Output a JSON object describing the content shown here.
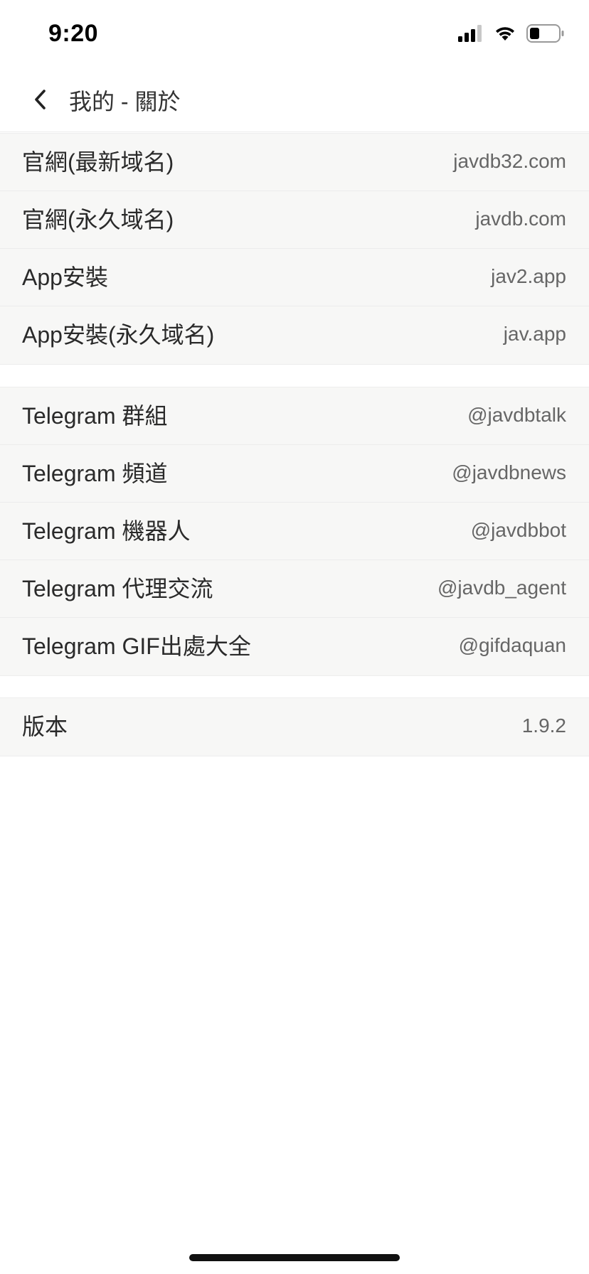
{
  "status_bar": {
    "time": "9:20",
    "icons": [
      "signal-icon",
      "wifi-icon",
      "battery-icon"
    ]
  },
  "nav": {
    "back_icon": "chevron-left-icon",
    "title": "我的 - 關於"
  },
  "groups": [
    {
      "rows": [
        {
          "label": "官網(最新域名)",
          "value": "javdb32.com"
        },
        {
          "label": "官網(永久域名)",
          "value": "javdb.com"
        },
        {
          "label": "App安裝",
          "value": "jav2.app"
        },
        {
          "label": "App安裝(永久域名)",
          "value": "jav.app"
        }
      ]
    },
    {
      "rows": [
        {
          "label": "Telegram 群組",
          "value": "@javdbtalk"
        },
        {
          "label": "Telegram 頻道",
          "value": "@javdbnews"
        },
        {
          "label": "Telegram 機器人",
          "value": "@javdbbot"
        },
        {
          "label": "Telegram 代理交流",
          "value": "@javdb_agent"
        },
        {
          "label": "Telegram GIF出處大全",
          "value": "@gifdaquan"
        }
      ]
    },
    {
      "rows": [
        {
          "label": "版本",
          "value": "1.9.2"
        }
      ]
    }
  ],
  "colors": {
    "row_background": "#f7f7f6",
    "label_text": "#2a2a2a",
    "value_text": "#666666"
  }
}
